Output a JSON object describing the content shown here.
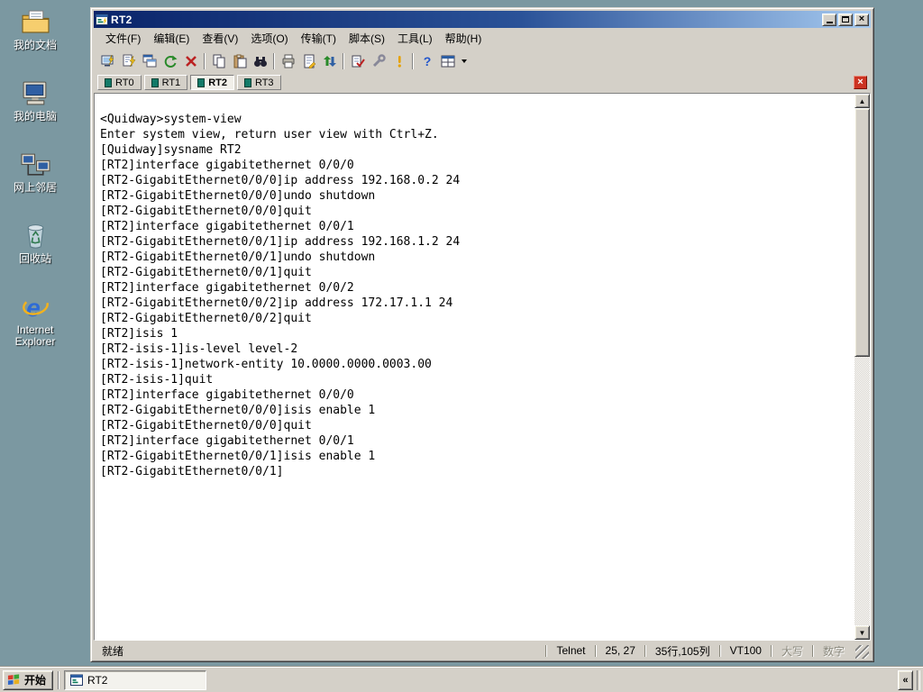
{
  "colors": {
    "desktop": "#7B98A1",
    "chrome": "#D4D0C8",
    "title_left": "#0A246A",
    "title_right": "#A6CAF0",
    "terminal_bg": "#FFFFFF",
    "terminal_fg": "#000000",
    "close_tab_red": "#CC3322"
  },
  "icons": {
    "scroll_up": "▲",
    "scroll_down": "▼",
    "close": "×",
    "overflow": "«"
  },
  "desktop_icons": [
    {
      "name": "my-documents",
      "label": "我的文档"
    },
    {
      "name": "my-computer",
      "label": "我的电脑"
    },
    {
      "name": "network-places",
      "label": "网上邻居"
    },
    {
      "name": "recycle-bin",
      "label": "回收站"
    },
    {
      "name": "internet-explorer",
      "label": "Internet Explorer"
    }
  ],
  "window": {
    "title": "RT2",
    "menu_items": [
      "文件(F)",
      "编辑(E)",
      "查看(V)",
      "选项(O)",
      "传输(T)",
      "脚本(S)",
      "工具(L)",
      "帮助(H)"
    ],
    "toolbar_icons": [
      "connect",
      "quick-connect",
      "new-window",
      "reconnect",
      "disconnect",
      "copy",
      "paste",
      "find",
      "print",
      "log-session",
      "file-transfer",
      "session-options",
      "global-options",
      "alert",
      "help",
      "windows"
    ],
    "tabs": [
      {
        "label": "RT0",
        "active": false
      },
      {
        "label": "RT1",
        "active": false
      },
      {
        "label": "RT2",
        "active": true
      },
      {
        "label": "RT3",
        "active": false
      }
    ],
    "terminal": {
      "lines": [
        "",
        "<Quidway>system-view",
        "Enter system view, return user view with Ctrl+Z.",
        "[Quidway]sysname RT2",
        "[RT2]interface gigabitethernet 0/0/0",
        "[RT2-GigabitEthernet0/0/0]ip address 192.168.0.2 24",
        "[RT2-GigabitEthernet0/0/0]undo shutdown",
        "[RT2-GigabitEthernet0/0/0]quit",
        "[RT2]interface gigabitethernet 0/0/1",
        "[RT2-GigabitEthernet0/0/1]ip address 192.168.1.2 24",
        "[RT2-GigabitEthernet0/0/1]undo shutdown",
        "[RT2-GigabitEthernet0/0/1]quit",
        "[RT2]interface gigabitethernet 0/0/2",
        "[RT2-GigabitEthernet0/0/2]ip address 172.17.1.1 24",
        "[RT2-GigabitEthernet0/0/2]quit",
        "[RT2]isis 1",
        "[RT2-isis-1]is-level level-2",
        "[RT2-isis-1]network-entity 10.0000.0000.0003.00",
        "[RT2-isis-1]quit",
        "[RT2]interface gigabitethernet 0/0/0",
        "[RT2-GigabitEthernet0/0/0]isis enable 1",
        "[RT2-GigabitEthernet0/0/0]quit",
        "[RT2]interface gigabitethernet 0/0/1",
        "[RT2-GigabitEthernet0/0/1]isis enable 1",
        "[RT2-GigabitEthernet0/0/1]"
      ]
    },
    "status": {
      "ready": "就绪",
      "protocol": "Telnet",
      "cursor": "25, 27",
      "size": "35行,105列",
      "emulation": "VT100",
      "caps": "大写",
      "num": "数字"
    }
  },
  "taskbar": {
    "start_label": "开始",
    "task_label": "RT2"
  }
}
